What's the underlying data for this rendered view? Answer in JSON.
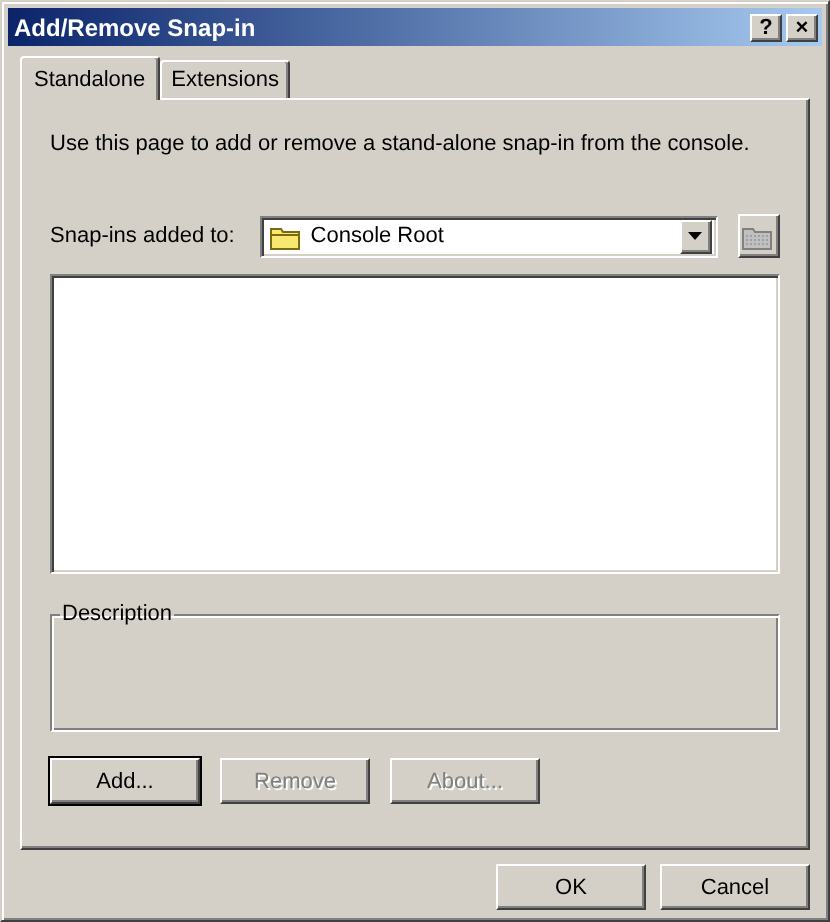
{
  "window": {
    "title": "Add/Remove Snap-in",
    "title_buttons": [
      "?",
      "×"
    ]
  },
  "tabs": [
    {
      "label": "Standalone",
      "selected": true
    },
    {
      "label": "Extensions",
      "selected": false
    }
  ],
  "intro": "Use this page to add or remove a stand-alone snap-in from the console.",
  "snapins_added_to": {
    "label": "Snap-ins added to:",
    "value": "Console Root",
    "browse_disabled": true
  },
  "description": {
    "label": "Description"
  },
  "actions": [
    {
      "label": "Add...",
      "disabled": false,
      "default": true
    },
    {
      "label": "Remove",
      "disabled": true,
      "default": false
    },
    {
      "label": "About...",
      "disabled": true,
      "default": false
    }
  ],
  "buttons": [
    "OK",
    "Cancel"
  ]
}
